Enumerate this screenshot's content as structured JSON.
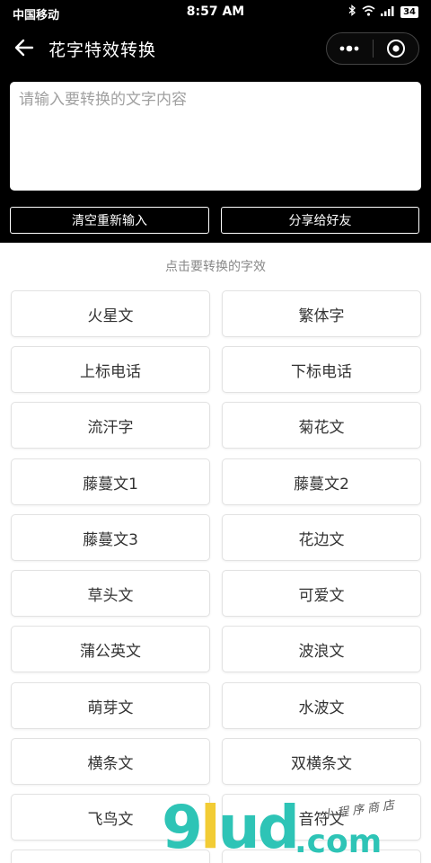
{
  "status_bar": {
    "carrier": "中国移动",
    "time": "8:57 AM",
    "battery": "34"
  },
  "nav": {
    "title": "花字特效转换"
  },
  "input": {
    "placeholder": "请输入要转换的文字内容",
    "value": ""
  },
  "actions": {
    "clear_label": "清空重新输入",
    "share_label": "分享给好友"
  },
  "hint": "点击要转换的字效",
  "effects": [
    "火星文",
    "繁体字",
    "上标电话",
    "下标电话",
    "流汗字",
    "菊花文",
    "藤蔓文1",
    "藤蔓文2",
    "藤蔓文3",
    "花边文",
    "草头文",
    "可爱文",
    "蒲公英文",
    "波浪文",
    "萌芽文",
    "水波文",
    "横条文",
    "双横条文",
    "飞鸟文",
    "音符文"
  ],
  "watermark": {
    "logo": "9lud",
    "suffix": ".com",
    "script": "小程序商店"
  },
  "colors": {
    "header_bg": "#000000",
    "watermark_teal": "#2ec4b6",
    "watermark_yellow": "#f2cc35"
  }
}
